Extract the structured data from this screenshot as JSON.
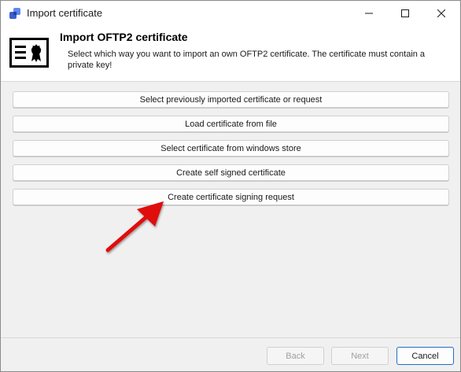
{
  "window": {
    "title": "Import certificate"
  },
  "titlebar": {
    "minimize_icon": "minimize-icon",
    "maximize_icon": "maximize-icon",
    "close_icon": "close-icon"
  },
  "header": {
    "title": "Import OFTP2 certificate",
    "description": "Select which way you want to import an own OFTP2 certificate. The certificate must contain a private key!",
    "icon": "certificate-icon"
  },
  "options": [
    {
      "label": "Select previously imported certificate or request"
    },
    {
      "label": "Load certificate from file"
    },
    {
      "label": "Select certificate from windows store"
    },
    {
      "label": "Create self signed certificate"
    },
    {
      "label": "Create certificate signing request"
    }
  ],
  "footer": {
    "back_label": "Back",
    "next_label": "Next",
    "cancel_label": "Cancel"
  },
  "colors": {
    "accent": "#1e6fc7",
    "arrow": "#e01010"
  }
}
